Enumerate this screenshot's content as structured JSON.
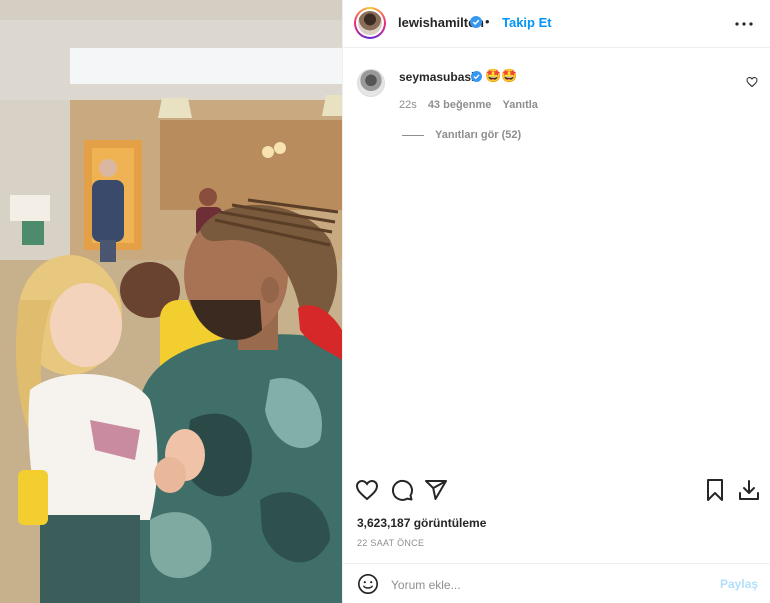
{
  "post": {
    "author": "lewishamilton",
    "separator": "•",
    "follow_label": "Takip Et",
    "more_icon": "more-horizontal-icon"
  },
  "comment": {
    "username": "seymasubasi",
    "text": "🤩🤩",
    "time": "22s",
    "likes": "43 beğenme",
    "reply_label": "Yanıtla",
    "view_replies": "Yanıtları gör (52)"
  },
  "actions": {
    "like_icon": "heart-icon",
    "comment_icon": "comment-icon",
    "share_icon": "share-icon",
    "save_icon": "bookmark-icon",
    "download_icon": "download-icon"
  },
  "stats": {
    "views": "3,623,187 görüntüleme",
    "time_ago": "22 SAAT ÖNCE"
  },
  "add_comment": {
    "placeholder": "Yorum ekle...",
    "post_label": "Paylaş"
  },
  "colors": {
    "accent": "#0095f6",
    "post_disabled": "#b2dffc",
    "muted": "#8e8e8e"
  }
}
